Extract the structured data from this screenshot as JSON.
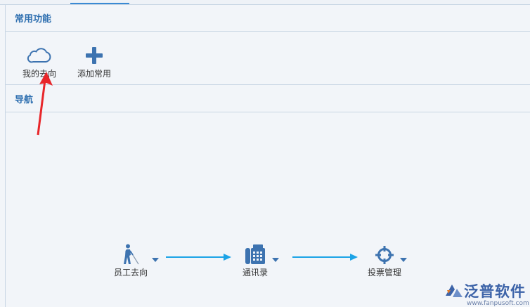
{
  "sections": {
    "common_functions": {
      "title": "常用功能"
    },
    "navigation": {
      "title": "导航"
    }
  },
  "quick_items": [
    {
      "label": "我的去向",
      "icon": "cloud-icon"
    },
    {
      "label": "添加常用",
      "icon": "plus-icon"
    }
  ],
  "flow_nodes": [
    {
      "label": "员工去向",
      "icon": "walking-person-icon"
    },
    {
      "label": "通讯录",
      "icon": "telephone-icon"
    },
    {
      "label": "投票管理",
      "icon": "crosshair-icon"
    }
  ],
  "colors": {
    "header_text": "#2e6fb0",
    "icon_blue": "#3d73b0",
    "flow_arrow": "#1ca3e6",
    "annotation_arrow": "#e8262a",
    "logo_blue": "#3c63a8"
  },
  "logo": {
    "name": "泛普软件",
    "domain": "www.fanpusoft.com"
  }
}
